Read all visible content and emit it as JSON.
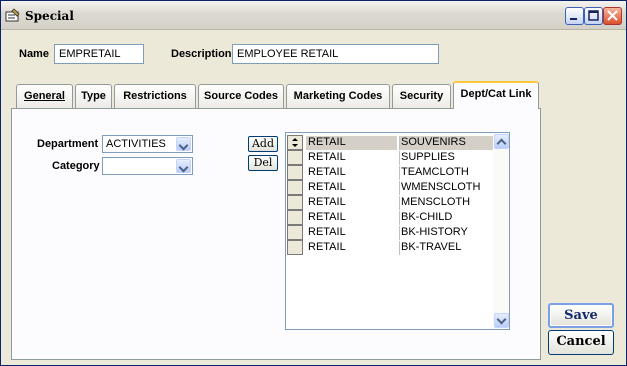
{
  "window": {
    "title": "Special"
  },
  "form": {
    "name_label": "Name",
    "name_value": "EMPRETAIL",
    "description_label": "Description",
    "description_value": "EMPLOYEE RETAIL"
  },
  "tabs": [
    {
      "label": "General",
      "active": false
    },
    {
      "label": "Type",
      "active": false
    },
    {
      "label": "Restrictions",
      "active": false
    },
    {
      "label": "Source Codes",
      "active": false
    },
    {
      "label": "Marketing Codes",
      "active": false
    },
    {
      "label": "Security",
      "active": false
    },
    {
      "label": "Dept/Cat Link",
      "active": true
    }
  ],
  "dept_cat": {
    "department_label": "Department",
    "department_value": "ACTIVITIES",
    "category_label": "Category",
    "category_value": "",
    "add_label": "Add",
    "del_label": "Del",
    "rows": [
      {
        "dept": "RETAIL",
        "cat": "SOUVENIRS"
      },
      {
        "dept": "RETAIL",
        "cat": "SUPPLIES"
      },
      {
        "dept": "RETAIL",
        "cat": "TEAMCLOTH"
      },
      {
        "dept": "RETAIL",
        "cat": "WMENSCLOTH"
      },
      {
        "dept": "RETAIL",
        "cat": "MENSCLOTH"
      },
      {
        "dept": "RETAIL",
        "cat": "BK-CHILD"
      },
      {
        "dept": "RETAIL",
        "cat": "BK-HISTORY"
      },
      {
        "dept": "RETAIL",
        "cat": "BK-TRAVEL"
      }
    ]
  },
  "buttons": {
    "save": "Save",
    "cancel": "Cancel"
  }
}
